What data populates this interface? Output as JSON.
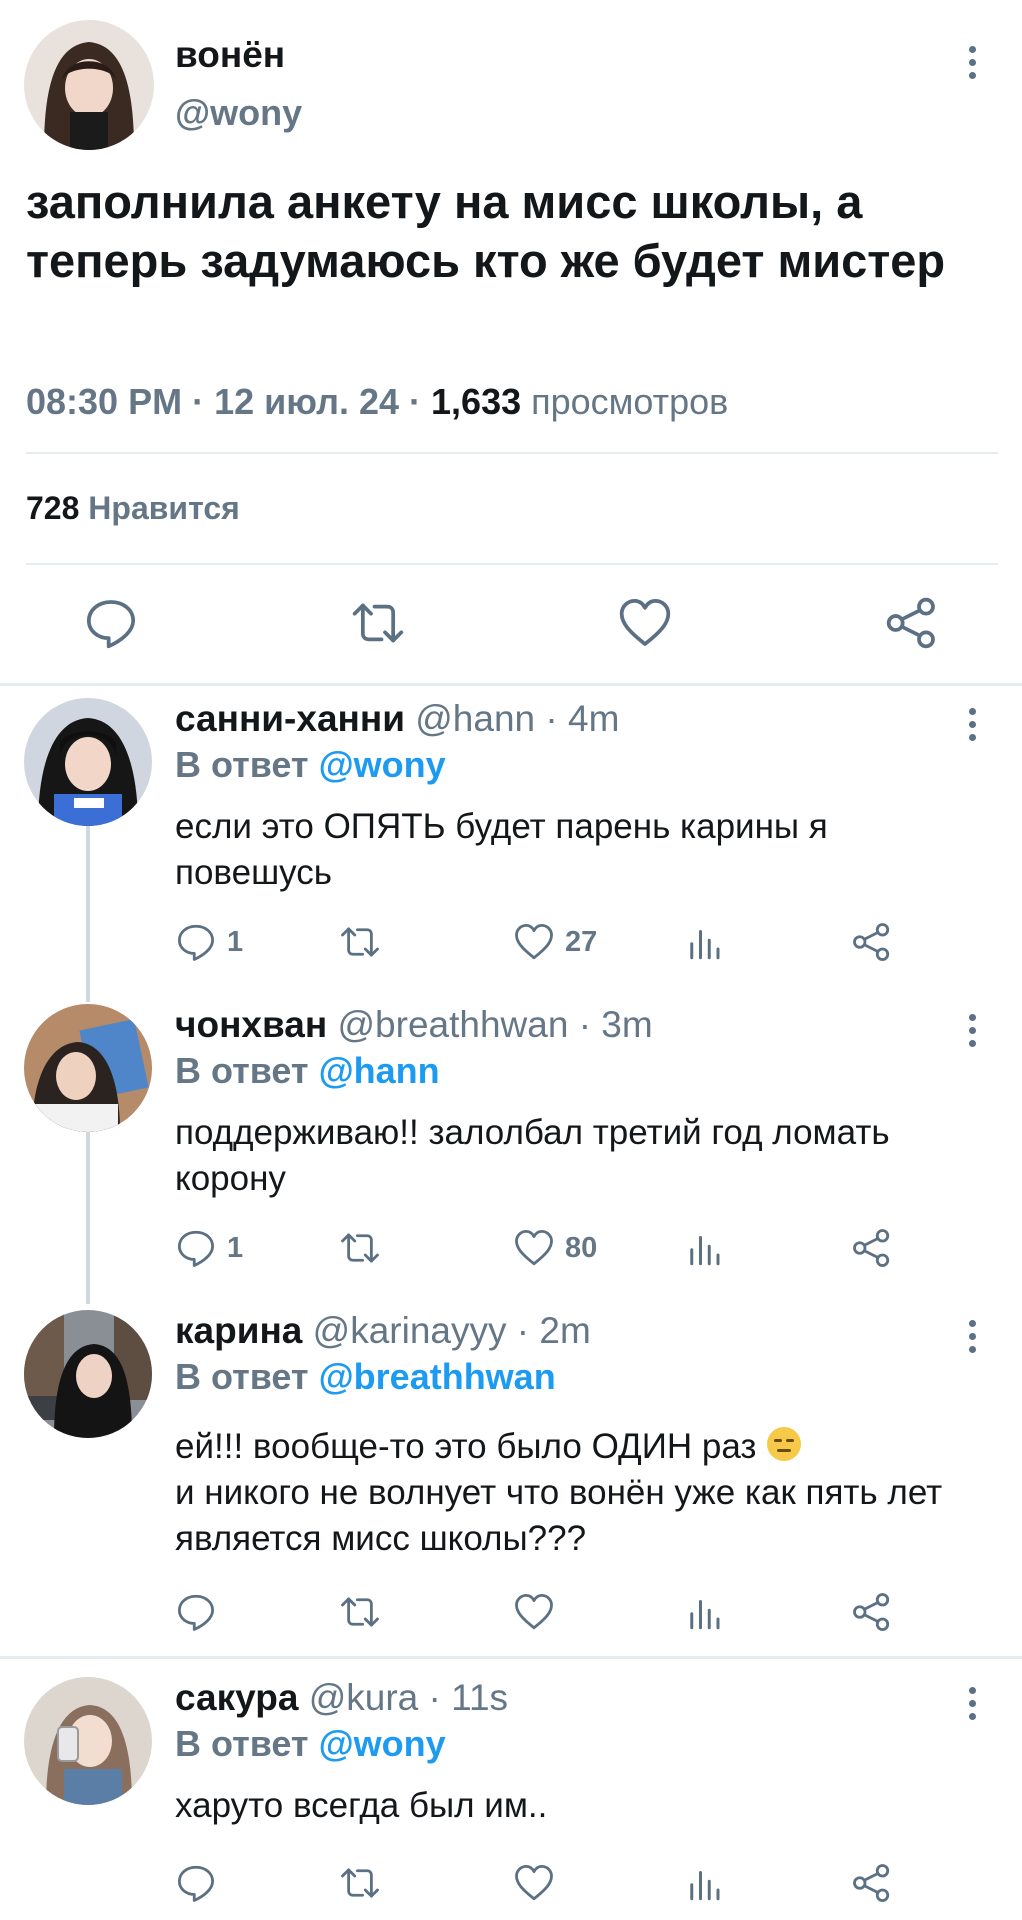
{
  "main_tweet": {
    "author_name": "вонён",
    "author_handle": "@wony",
    "text": "заполнила анкету на мисс школы, а теперь задумаюсь кто же будет мистер",
    "time": "08:30 PM",
    "sep1": " · ",
    "date": "12 июл. 24",
    "sep2": " · ",
    "views_count": "1,633",
    "views_label": " просмотров",
    "likes_count": "728",
    "likes_label": " Нравится",
    "actions": [
      "reply-icon",
      "retweet-icon",
      "heart-icon",
      "share-icon"
    ]
  },
  "replies": [
    {
      "name": "санни-ханни",
      "handle": "@hann",
      "time": "· 4m",
      "reply_prefix": "В ответ ",
      "reply_to": "@wony",
      "text": "если это ОПЯТЬ будет парень карины я повешусь",
      "reply_count": "1",
      "like_count": "27"
    },
    {
      "name": "чонхван",
      "handle": "@breathhwan",
      "time": "· 3m",
      "reply_prefix": "В ответ ",
      "reply_to": "@hann",
      "text": "поддерживаю!! залолбал третий год ломать корону",
      "reply_count": "1",
      "like_count": "80"
    },
    {
      "name": "карина",
      "handle": "@karinayyy",
      "time": "· 2m",
      "reply_prefix": "В ответ ",
      "reply_to": "@breathhwan",
      "text_line1": "ей!!! вообще-то это было ОДИН раз",
      "emoji": "expressionless-face-icon",
      "text_rest": "и никого не волнует что вонён уже как пять лет является мисс школы???",
      "reply_count": "",
      "like_count": ""
    },
    {
      "name": "сакура",
      "handle": "@kura",
      "time": "· 11s",
      "reply_prefix": "В ответ ",
      "reply_to": "@wony",
      "text": "харуто всегда был им..",
      "reply_count": "",
      "like_count": ""
    }
  ],
  "colors": {
    "text": "#14171a",
    "secondary": "#657786",
    "link": "#1d9bf0",
    "divider": "#e6ecf0",
    "icon": "#5b7083"
  }
}
